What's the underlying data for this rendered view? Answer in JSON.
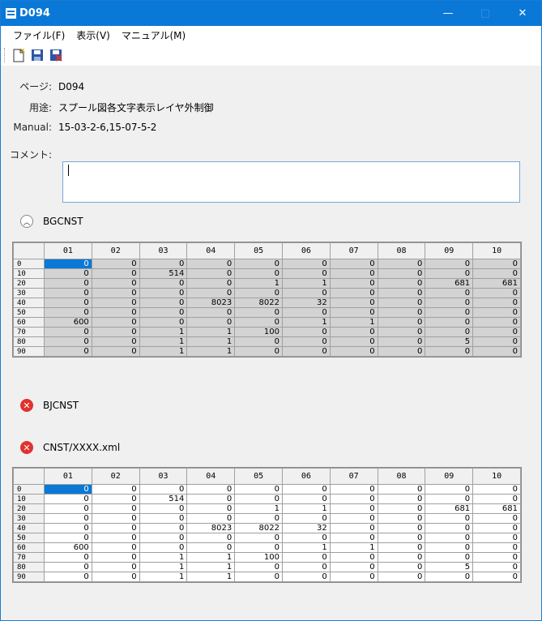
{
  "window": {
    "title": "D094",
    "minimize": "—",
    "maximize": "□",
    "close": "✕"
  },
  "menu": [
    "ファイル(F)",
    "表示(V)",
    "マニュアル(M)"
  ],
  "toolbar": {
    "icons": [
      "new-document-icon",
      "save-icon",
      "close-doc-icon"
    ]
  },
  "info": {
    "page_label": "ページ:",
    "page_value": "D094",
    "usage_label": "用途:",
    "usage_value": "スプール図各文字表示レイヤ外制御",
    "manual_label": "Manual:",
    "manual_value": "15-03-2-6,15-07-5-2",
    "comment_label": "コメント:",
    "comment_value": ""
  },
  "sections": {
    "bgcnst": {
      "label": "BGCNST",
      "state": "expanded"
    },
    "bjcnst": {
      "label": "BJCNST",
      "state": "error"
    },
    "cnst": {
      "label": "CNST/XXXX.xml",
      "state": "error"
    }
  },
  "grid": {
    "columns": [
      "01",
      "02",
      "03",
      "04",
      "05",
      "06",
      "07",
      "08",
      "09",
      "10"
    ],
    "rows": [
      {
        "label": "0",
        "values": [
          "0",
          "0",
          "0",
          "0",
          "0",
          "0",
          "0",
          "0",
          "0",
          "0"
        ]
      },
      {
        "label": "10",
        "values": [
          "0",
          "0",
          "514",
          "0",
          "0",
          "0",
          "0",
          "0",
          "0",
          "0"
        ]
      },
      {
        "label": "20",
        "values": [
          "0",
          "0",
          "0",
          "0",
          "1",
          "1",
          "0",
          "0",
          "681",
          "681"
        ]
      },
      {
        "label": "30",
        "values": [
          "0",
          "0",
          "0",
          "0",
          "0",
          "0",
          "0",
          "0",
          "0",
          "0"
        ]
      },
      {
        "label": "40",
        "values": [
          "0",
          "0",
          "0",
          "8023",
          "8022",
          "32",
          "0",
          "0",
          "0",
          "0"
        ]
      },
      {
        "label": "50",
        "values": [
          "0",
          "0",
          "0",
          "0",
          "0",
          "0",
          "0",
          "0",
          "0",
          "0"
        ]
      },
      {
        "label": "60",
        "values": [
          "600",
          "0",
          "0",
          "0",
          "0",
          "1",
          "1",
          "0",
          "0",
          "0"
        ]
      },
      {
        "label": "70",
        "values": [
          "0",
          "0",
          "1",
          "1",
          "100",
          "0",
          "0",
          "0",
          "0",
          "0"
        ]
      },
      {
        "label": "80",
        "values": [
          "0",
          "0",
          "1",
          "1",
          "0",
          "0",
          "0",
          "0",
          "5",
          "0"
        ]
      },
      {
        "label": "90",
        "values": [
          "0",
          "0",
          "1",
          "1",
          "0",
          "0",
          "0",
          "0",
          "0",
          "0"
        ]
      }
    ]
  },
  "colors": {
    "title_bar": "#0a78d7",
    "selection": "#0a78d7",
    "error": "#e0322f"
  }
}
